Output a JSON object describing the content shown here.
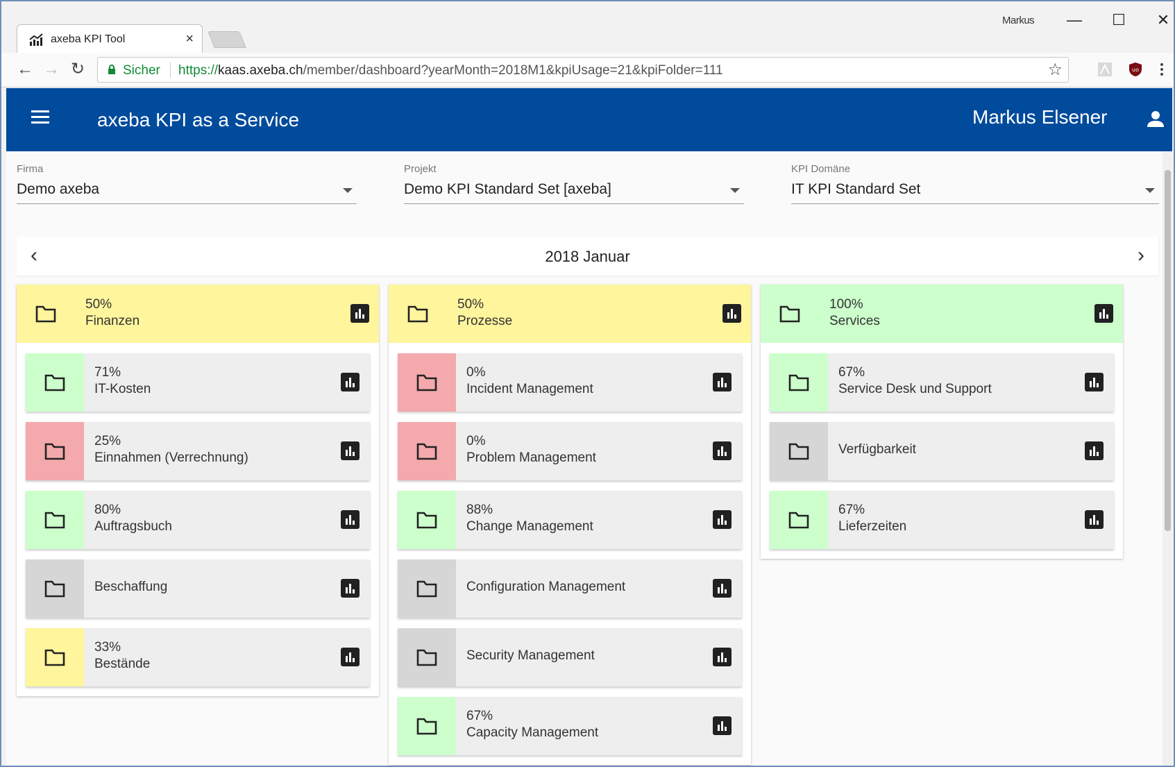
{
  "browser": {
    "tab_title": "axeba KPI Tool",
    "tab_close": "×",
    "window_user": "Markus",
    "minimize": "—",
    "maximize": "☐",
    "close": "✕",
    "back": "←",
    "forward": "→",
    "reload": "↻",
    "secure_label": "Sicher",
    "url_scheme": "https://",
    "url_host": "kaas.axeba.ch",
    "url_path": "/member/dashboard?yearMonth=2018M1&kpiUsage=21&kpiFolder=111",
    "bookmark": "☆"
  },
  "app": {
    "title": "axeba KPI as a Service",
    "user_name": "Markus Elsener",
    "primary_color": "#004b9c"
  },
  "filters": {
    "firma": {
      "label": "Firma",
      "value": "Demo axeba"
    },
    "projekt": {
      "label": "Projekt",
      "value": "Demo KPI Standard Set [axeba]"
    },
    "domaene": {
      "label": "KPI Domäne",
      "value": "IT KPI Standard Set"
    }
  },
  "month": {
    "prev": "‹",
    "label": "2018 Januar",
    "next": "›"
  },
  "status_colors": {
    "green": "#ccffcc",
    "red": "#f4a9ac",
    "grey": "#d6d6d6",
    "yellow": "#fff59d"
  },
  "columns": [
    {
      "pct": "50%",
      "name": "Finanzen",
      "status": "yellow",
      "items": [
        {
          "pct": "71%",
          "name": "IT-Kosten",
          "status": "green"
        },
        {
          "pct": "25%",
          "name": "Einnahmen (Verrechnung)",
          "status": "red"
        },
        {
          "pct": "80%",
          "name": "Auftragsbuch",
          "status": "green"
        },
        {
          "pct": "",
          "name": "Beschaffung",
          "status": "grey"
        },
        {
          "pct": "33%",
          "name": "Bestände",
          "status": "yellow"
        }
      ]
    },
    {
      "pct": "50%",
      "name": "Prozesse",
      "status": "yellow",
      "items": [
        {
          "pct": "0%",
          "name": "Incident Management",
          "status": "red"
        },
        {
          "pct": "0%",
          "name": "Problem Management",
          "status": "red"
        },
        {
          "pct": "88%",
          "name": "Change Management",
          "status": "green"
        },
        {
          "pct": "",
          "name": "Configuration Management",
          "status": "grey"
        },
        {
          "pct": "",
          "name": "Security Management",
          "status": "grey"
        },
        {
          "pct": "67%",
          "name": "Capacity Management",
          "status": "green"
        }
      ]
    },
    {
      "pct": "100%",
      "name": "Services",
      "status": "green",
      "items": [
        {
          "pct": "67%",
          "name": "Service Desk und Support",
          "status": "green"
        },
        {
          "pct": "",
          "name": "Verfügbarkeit",
          "status": "grey"
        },
        {
          "pct": "67%",
          "name": "Lieferzeiten",
          "status": "green"
        }
      ]
    }
  ]
}
